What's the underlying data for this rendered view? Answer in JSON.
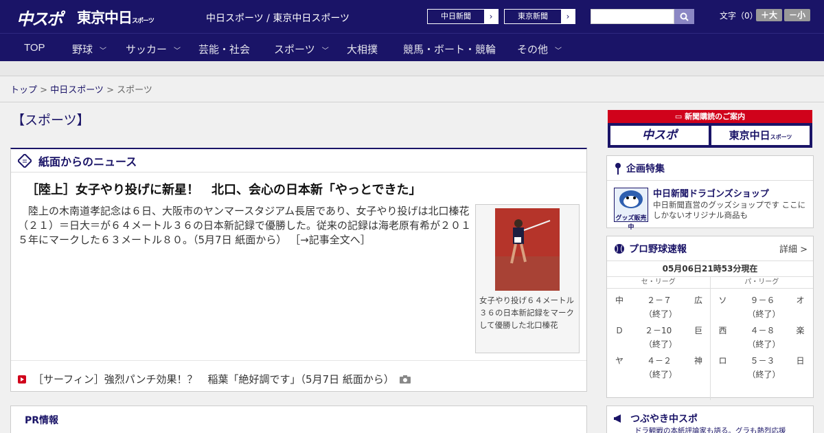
{
  "header": {
    "logo_main": "中スポ",
    "logo_tokyo": "東京中日",
    "logo_tokyo_small": "スポーツ",
    "site_title": "中日スポーツ / 東京中日スポーツ",
    "paper1": "中日新聞",
    "paper2": "東京新聞",
    "font_size_label": "文字（0）",
    "font_up": "＋大",
    "font_down": "－小"
  },
  "nav": [
    {
      "label": "TOP",
      "dd": false
    },
    {
      "label": "野球",
      "dd": true
    },
    {
      "label": "サッカー",
      "dd": true
    },
    {
      "label": "芸能・社会",
      "dd": false
    },
    {
      "label": "スポーツ",
      "dd": true
    },
    {
      "label": "大相撲",
      "dd": false
    },
    {
      "label": "競馬・ボート・競輪",
      "dd": false
    },
    {
      "label": "その他",
      "dd": true
    }
  ],
  "breadcrumb": {
    "top": "トップ",
    "mid": "中日スポーツ",
    "current": "スポーツ"
  },
  "page_title": "【スポーツ】",
  "section": {
    "heading": "紙面からのニュース",
    "headline": "［陸上］女子やり投げに新星！　北口、会心の日本新「やっとできた」",
    "body": "　陸上の木南道孝記念は６日、大阪市のヤンマースタジアム長居であり、女子やり投げは北口榛花（２１）＝日大＝が６４メートル３６の日本新記録で優勝した。従来の記録は海老原有希が２０１５年にマークした６３メートル８０。（5月7日 紙面から） ［→記事全文へ］",
    "caption": "女子やり投げ６４メートル３６の日本新記録をマークして優勝した北口榛花",
    "sub_link": "［サーフィン］強烈パンチ効果！？　稲葉「絶好調です」（5月7日 紙面から）"
  },
  "pr": "PR情報",
  "sidebar": {
    "subs_title": "新聞購読のご案内",
    "subs1": "中スポ",
    "subs2": "東京中日",
    "subs2_small": "スポーツ",
    "special_title": "企画特集",
    "shop_title": "中日新聞ドラゴンズショップ",
    "shop_desc": "中日新聞直営のグッズショップです ここにしかないオリジナル商品も",
    "shop_badge": "グッズ販売中",
    "baseball_title": "プロ野球速報",
    "baseball_more": "詳細 >",
    "baseball_time": "05月06日21時53分現在",
    "league1": "セ・リーグ",
    "league2": "パ・リーグ",
    "games": [
      {
        "c": "中",
        "s": "２－７",
        "h": "広",
        "p": "ソ",
        "ps": "９－６",
        "ph": "オ"
      },
      {
        "c": "Ｄ",
        "s": "２－10",
        "h": "巨",
        "p": "西",
        "ps": "４－８",
        "ph": "楽"
      },
      {
        "c": "ヤ",
        "s": "４－２",
        "h": "神",
        "p": "ロ",
        "ps": "５－３",
        "ph": "日"
      }
    ],
    "final": "（終了）",
    "tweet_title": "つぶやき中スポ",
    "tweet_desc": "ドラ観戦の本紙評論家も語る。グラも熱烈応援"
  }
}
